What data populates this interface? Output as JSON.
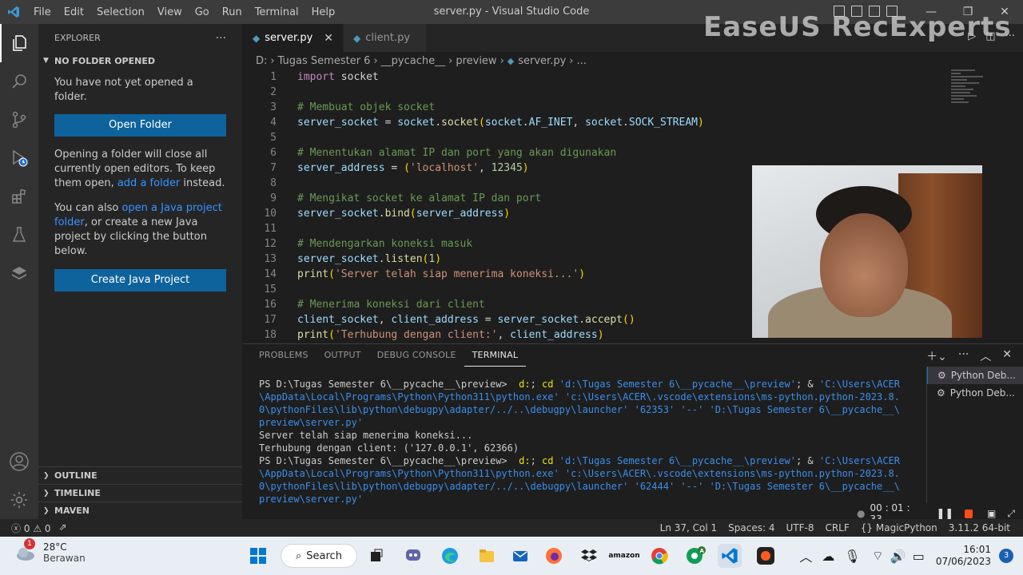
{
  "window": {
    "title": "server.py - Visual Studio Code"
  },
  "menu": [
    "File",
    "Edit",
    "Selection",
    "View",
    "Go",
    "Run",
    "Terminal",
    "Help"
  ],
  "watermark": "EaseUS RecExperts",
  "explorer": {
    "header": "EXPLORER",
    "more": "···",
    "section": "NO FOLDER OPENED",
    "intro": "You have not yet opened a folder.",
    "open_folder_button": "Open Folder",
    "text1_a": "Opening a folder will close all currently open editors. To keep them open, ",
    "text1_link": "add a folder",
    "text1_b": " instead.",
    "text2_a": "You can also ",
    "text2_link": "open a Java project folder",
    "text2_b": ", or create a new Java project by clicking the button below.",
    "create_java_button": "Create Java Project",
    "bottom_sections": [
      "OUTLINE",
      "TIMELINE",
      "MAVEN"
    ]
  },
  "tabs": [
    {
      "label": "server.py",
      "active": true
    },
    {
      "label": "client.py",
      "active": false
    }
  ],
  "breadcrumb": [
    "D:",
    "Tugas Semester 6",
    "__pycache__",
    "preview",
    "server.py",
    "..."
  ],
  "code": [
    {
      "n": "1",
      "parts": [
        [
          "kw",
          "import"
        ],
        [
          "txt",
          " socket"
        ]
      ]
    },
    {
      "n": "2",
      "parts": []
    },
    {
      "n": "3",
      "parts": [
        [
          "cm",
          "# Membuat objek socket"
        ]
      ]
    },
    {
      "n": "4",
      "parts": [
        [
          "var",
          "server_socket"
        ],
        [
          "txt",
          " = "
        ],
        [
          "var",
          "socket"
        ],
        [
          "txt",
          "."
        ],
        [
          "fn",
          "socket"
        ],
        [
          "br",
          "("
        ],
        [
          "var",
          "socket"
        ],
        [
          "txt",
          "."
        ],
        [
          "var",
          "AF_INET"
        ],
        [
          "txt",
          ", "
        ],
        [
          "var",
          "socket"
        ],
        [
          "txt",
          "."
        ],
        [
          "var",
          "SOCK_STREAM"
        ],
        [
          "br",
          ")"
        ]
      ]
    },
    {
      "n": "5",
      "parts": []
    },
    {
      "n": "6",
      "parts": [
        [
          "cm",
          "# Menentukan alamat IP dan port yang akan digunakan"
        ]
      ]
    },
    {
      "n": "7",
      "parts": [
        [
          "var",
          "server_address"
        ],
        [
          "txt",
          " = "
        ],
        [
          "br",
          "("
        ],
        [
          "str",
          "'localhost'"
        ],
        [
          "txt",
          ", "
        ],
        [
          "num",
          "12345"
        ],
        [
          "br",
          ")"
        ]
      ]
    },
    {
      "n": "8",
      "parts": []
    },
    {
      "n": "9",
      "parts": [
        [
          "cm",
          "# Mengikat socket ke alamat IP dan port"
        ]
      ]
    },
    {
      "n": "10",
      "parts": [
        [
          "var",
          "server_socket"
        ],
        [
          "txt",
          "."
        ],
        [
          "fn",
          "bind"
        ],
        [
          "br",
          "("
        ],
        [
          "var",
          "server_address"
        ],
        [
          "br",
          ")"
        ]
      ]
    },
    {
      "n": "11",
      "parts": []
    },
    {
      "n": "12",
      "parts": [
        [
          "cm",
          "# Mendengarkan koneksi masuk"
        ]
      ]
    },
    {
      "n": "13",
      "parts": [
        [
          "var",
          "server_socket"
        ],
        [
          "txt",
          "."
        ],
        [
          "fn",
          "listen"
        ],
        [
          "br",
          "("
        ],
        [
          "num",
          "1"
        ],
        [
          "br",
          ")"
        ]
      ]
    },
    {
      "n": "14",
      "parts": [
        [
          "fn",
          "print"
        ],
        [
          "br",
          "("
        ],
        [
          "str",
          "'Server telah siap menerima koneksi...'"
        ],
        [
          "br",
          ")"
        ]
      ]
    },
    {
      "n": "15",
      "parts": []
    },
    {
      "n": "16",
      "parts": [
        [
          "cm",
          "# Menerima koneksi dari client"
        ]
      ]
    },
    {
      "n": "17",
      "parts": [
        [
          "var",
          "client_socket"
        ],
        [
          "txt",
          ", "
        ],
        [
          "var",
          "client_address"
        ],
        [
          "txt",
          " = "
        ],
        [
          "var",
          "server_socket"
        ],
        [
          "txt",
          "."
        ],
        [
          "fn",
          "accept"
        ],
        [
          "br",
          "()"
        ]
      ]
    },
    {
      "n": "18",
      "parts": [
        [
          "fn",
          "print"
        ],
        [
          "br",
          "("
        ],
        [
          "str",
          "'Terhubung dengan client:'"
        ],
        [
          "txt",
          ", "
        ],
        [
          "var",
          "client_address"
        ],
        [
          "br",
          ")"
        ]
      ]
    }
  ],
  "panel": {
    "tabs": [
      "PROBLEMS",
      "OUTPUT",
      "DEBUG CONSOLE",
      "TERMINAL"
    ],
    "active_tab": "TERMINAL",
    "terminals": [
      "Python Deb...",
      "Python Deb..."
    ],
    "lines": [
      [
        [
          "txt",
          "PS D:\\Tugas Semester 6\\__pycache__\\preview> "
        ],
        [
          "y",
          " d:"
        ],
        [
          "txt",
          "; "
        ],
        [
          "y",
          "cd "
        ],
        [
          "b",
          "'d:\\Tugas Semester 6\\__pycache__\\preview'"
        ],
        [
          "txt",
          "; & "
        ],
        [
          "b",
          "'C:\\Users\\ACER"
        ]
      ],
      [
        [
          "b",
          "\\AppData\\Local\\Programs\\Python\\Python311\\python.exe' 'c:\\Users\\ACER\\.vscode\\extensions\\ms-python.python-2023.8."
        ]
      ],
      [
        [
          "b",
          "0\\pythonFiles\\lib\\python\\debugpy\\adapter/../..\\debugpy\\launcher' '62353' '--' 'D:\\Tugas Semester 6\\__pycache__\\"
        ]
      ],
      [
        [
          "b",
          "preview\\server.py'"
        ]
      ],
      [
        [
          "txt",
          "Server telah siap menerima koneksi..."
        ]
      ],
      [
        [
          "txt",
          "Terhubung dengan client: ('127.0.0.1', 62366)"
        ]
      ],
      [
        [
          "txt",
          "PS D:\\Tugas Semester 6\\__pycache__\\preview> "
        ],
        [
          "y",
          " d:"
        ],
        [
          "txt",
          "; "
        ],
        [
          "y",
          "cd "
        ],
        [
          "b",
          "'d:\\Tugas Semester 6\\__pycache__\\preview'"
        ],
        [
          "txt",
          "; & "
        ],
        [
          "b",
          "'C:\\Users\\ACER"
        ]
      ],
      [
        [
          "b",
          "\\AppData\\Local\\Programs\\Python\\Python311\\python.exe' 'c:\\Users\\ACER\\.vscode\\extensions\\ms-python.python-2023.8."
        ]
      ],
      [
        [
          "b",
          "0\\pythonFiles\\lib\\python\\debugpy\\adapter/../..\\debugpy\\launcher' '62444' '--' 'D:\\Tugas Semester 6\\__pycache__\\"
        ]
      ],
      [
        [
          "b",
          "preview\\server.py'"
        ]
      ]
    ]
  },
  "recorder": {
    "time": "00 : 01 : 33"
  },
  "status": {
    "errors": "0",
    "warnings": "0",
    "position": "Ln 37, Col 1",
    "spaces": "Spaces: 4",
    "encoding": "UTF-8",
    "eol": "CRLF",
    "language": "MagicPython",
    "interpreter": "3.11.2 64-bit"
  },
  "taskbar": {
    "weather_badge": "1",
    "temperature": "28°C",
    "condition": "Berawan",
    "search": "Search",
    "amazon": "amazon",
    "time": "16:01",
    "date": "07/06/2023",
    "notifications": "3"
  },
  "colors": {
    "accent": "#007acc",
    "button": "#0e639c",
    "link": "#3794ff"
  }
}
